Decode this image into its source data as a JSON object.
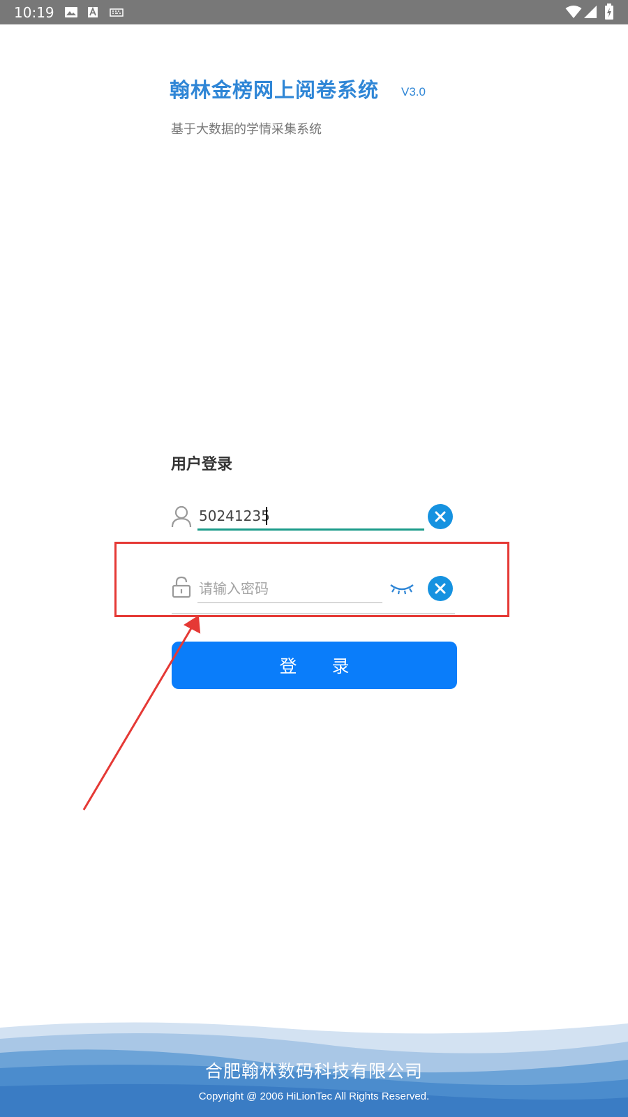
{
  "status_bar": {
    "time": "10:19",
    "left_icons": [
      "image-icon",
      "font-icon",
      "keyboard-icon"
    ],
    "right_icons": [
      "wifi-icon",
      "signal-icon",
      "battery-icon"
    ]
  },
  "header": {
    "title": "翰林金榜网上阅卷系统",
    "version": "V3.0",
    "subtitle": "基于大数据的学情采集系统"
  },
  "login": {
    "heading": "用户登录",
    "username_value": "50241235",
    "password_placeholder": "请输入密码",
    "button_label": "登　　录",
    "clear_icon": "close-icon",
    "password_toggle_icon": "eye-closed-icon"
  },
  "footer": {
    "company": "合肥翰林数码科技有限公司",
    "copyright": "Copyright @ 2006  HiLionTec All Rights Reserved."
  },
  "colors": {
    "brand_blue": "#2f86d6",
    "button_blue": "#0a7dfa",
    "clear_blue": "#1692e0",
    "active_underline": "#1b9b8a",
    "annotation_red": "#e53935",
    "status_bar": "#787878"
  }
}
